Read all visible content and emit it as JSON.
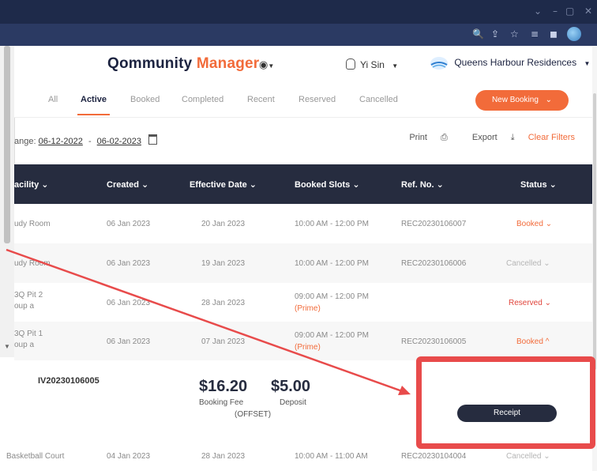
{
  "browser": {
    "window_controls": [
      "⌄",
      "–",
      "▢",
      "✕"
    ],
    "toolbar_icons": [
      "🔍",
      "⇪",
      "☆",
      "≡",
      "◼"
    ]
  },
  "app": {
    "brand_main": "Qommunity",
    "brand_accent": "Manager",
    "user": "Yi Sin",
    "property": "Queens Harbour Residences"
  },
  "tabs": [
    "All",
    "Active",
    "Booked",
    "Completed",
    "Recent",
    "Reserved",
    "Cancelled"
  ],
  "active_tab": "Active",
  "new_booking": "New Booking",
  "filters": {
    "range_label": "ange:",
    "from": "06-12-2022",
    "sep": "-",
    "to": "06-02-2023",
    "print": "Print",
    "export": "Export",
    "clear": "Clear Filters"
  },
  "columns": [
    "acility ⌄",
    "Created ⌄",
    "Effective Date ⌄",
    "Booked Slots ⌄",
    "Ref. No. ⌄",
    "Status ⌄"
  ],
  "rows": [
    {
      "facility": "udy Room",
      "facility2": "",
      "created": "06 Jan 2023",
      "effective": "20 Jan 2023",
      "slot": "10:00 AM - 12:00 PM",
      "prime": "",
      "ref": "REC20230106007",
      "status": "Booked ⌄"
    },
    {
      "facility": "udy Room",
      "facility2": "",
      "created": "06 Jan 2023",
      "effective": "19 Jan 2023",
      "slot": "10:00 AM - 12:00 PM",
      "prime": "",
      "ref": "REC20230106006",
      "status": "Cancelled ⌄"
    },
    {
      "facility": "3Q Pit 2",
      "facility2": "oup a",
      "created": "06 Jan 2023",
      "effective": "28 Jan 2023",
      "slot": "09:00 AM - 12:00 PM",
      "prime": "(Prime)",
      "ref": "",
      "status": "Reserved ⌄"
    },
    {
      "facility": "3Q Pit 1",
      "facility2": "oup a",
      "created": "06 Jan 2023",
      "effective": "07 Jan 2023",
      "slot": "09:00 AM - 12:00 PM",
      "prime": "(Prime)",
      "ref": "REC20230106005",
      "status": "Booked ^"
    },
    {
      "facility": "Basketball Court",
      "facility2": "",
      "created": "04 Jan 2023",
      "effective": "28 Jan 2023",
      "slot": "10:00 AM - 11:00 AM",
      "prime": "",
      "ref": "REC20230104004",
      "status": "Cancelled ⌄"
    }
  ],
  "detail": {
    "invoice": "IV20230106005",
    "booking_fee": "$16.20",
    "booking_fee_label": "Booking Fee",
    "deposit": "$5.00",
    "deposit_label": "Deposit",
    "offset": "(OFFSET)",
    "receipt": "Receipt"
  },
  "colors": {
    "accent": "#f26b3a",
    "header_dark": "#262c3f",
    "annotation_red": "#e84b4b"
  }
}
